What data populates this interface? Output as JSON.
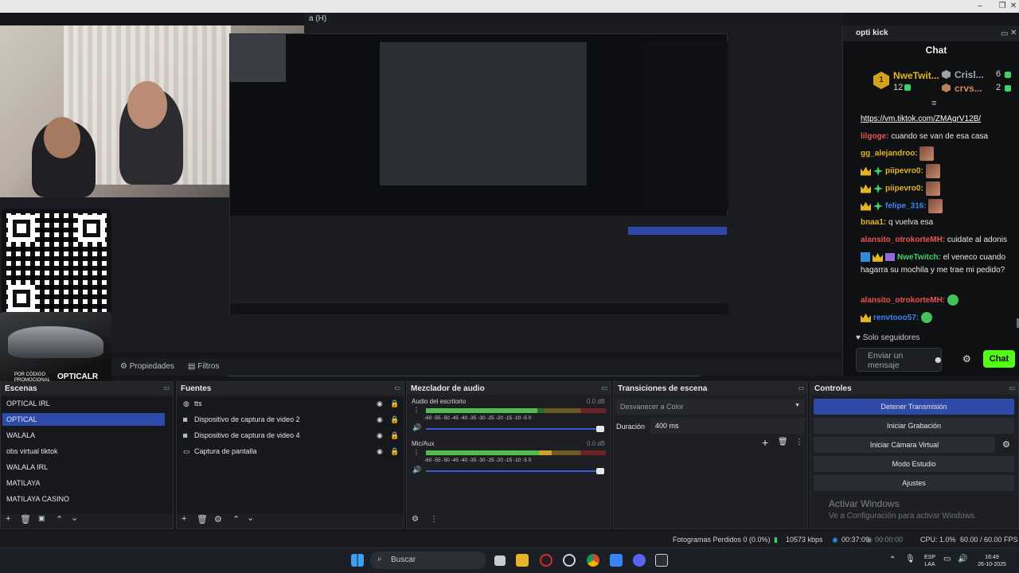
{
  "window": {
    "menu_fragment": "a (H)",
    "controls": [
      "–",
      "❐",
      "✕"
    ]
  },
  "preview": {
    "promo_small": "POR CÓDIGO PROMOCIONAL",
    "promo_code": "OPTICALR"
  },
  "chat_dock": {
    "title": "opti kick",
    "header": "Chat",
    "leaders": [
      {
        "name": "NweTwit...",
        "count": "12",
        "rank": "1"
      },
      {
        "name": "Crisl...",
        "count": "6"
      },
      {
        "name": "crvs...",
        "count": "2"
      }
    ],
    "messages": [
      {
        "user": "",
        "text": "https://vm.tiktok.com/ZMAgrV12B/"
      },
      {
        "user": "lilgoge:",
        "text": " cuando se van de esa casa"
      },
      {
        "user": "gg_alejandroo:",
        "text": ""
      },
      {
        "user": "piipevro0:",
        "text": ""
      },
      {
        "user": "piipevro0:",
        "text": ""
      },
      {
        "user": "felipe_316:",
        "text": ""
      },
      {
        "user": "bnaa1:",
        "text": " q vuelva esa"
      },
      {
        "user": "alansito_otrokorteMH:",
        "text": " cuidate al adonis"
      },
      {
        "user": "NweTwitch:",
        "text": " el veneco cuando hagarra su mochila y me trae mi pedido?"
      },
      {
        "user": "alansito_otrokorteMH:",
        "text": ""
      },
      {
        "user": "renvtooo57:",
        "text": ""
      }
    ],
    "followers_only": "Solo seguidores",
    "input_placeholder": "Enviar un mensaje",
    "send_label": "Chat",
    "colors": {
      "send": "#53fc18",
      "badge": "#d4a11e"
    }
  },
  "props_bar": {
    "properties": "Propiedades",
    "filters": "Filtros"
  },
  "scenes": {
    "title": "Escenas",
    "items": [
      "OPTICAL IRL",
      "OPTICAL",
      "WALALA",
      "obs virtual tiktok",
      "WALALA IRL",
      "MATILAYA",
      "MATILAYA CASINO"
    ],
    "selected": "OPTICAL"
  },
  "sources": {
    "title": "Fuentes",
    "items": [
      {
        "icon": "tts-icon",
        "label": "tts"
      },
      {
        "icon": "camera-icon",
        "label": "Dispositivo de captura de video 2"
      },
      {
        "icon": "camera-icon",
        "label": "Dispositivo de captura de video 4"
      },
      {
        "icon": "monitor-icon",
        "label": "Captura de pantalla"
      }
    ]
  },
  "mixer": {
    "title": "Mezclador de audio",
    "channels": [
      {
        "name": "Audio del escritorio",
        "db": "0.0 dB",
        "level": 0.62
      },
      {
        "name": "Mic/Aux",
        "db": "0.0 dB",
        "level": 0.7
      }
    ],
    "ticks": "-60  -55  -50  -45  -40  -35  -30  -25  -20  -15  -10   -5    0"
  },
  "transitions": {
    "title": "Transiciones de escena",
    "selected": "Desvanecer a Color",
    "duration_label": "Duración",
    "duration_value": "400 ms"
  },
  "controls": {
    "title": "Controles",
    "buttons": [
      "Detener Transmisión",
      "Iniciar Grabación",
      "Iniciar Cámara Virtual",
      "Modo Estudio",
      "Ajustes"
    ]
  },
  "activate": {
    "title": "Activar Windows",
    "sub": "Ve a Configuración para activar Windows."
  },
  "status": {
    "dropped": "Fotogramas Perdidos 0 (0.0%)",
    "bitrate": "10573 kbps",
    "stream_time": "00:37:09",
    "rec_time": "00:00:00",
    "cpu": "CPU: 1.0%",
    "fps": "60.00 / 60.00 FPS"
  },
  "taskbar": {
    "search": "Buscar",
    "lang": "ESP",
    "layout": "LAA",
    "time": "16:49",
    "date": "26-10-2025"
  }
}
